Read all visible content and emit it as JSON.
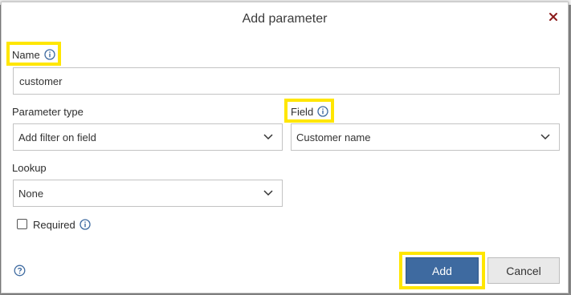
{
  "dialog": {
    "title": "Add parameter",
    "close_icon": "close-icon"
  },
  "name": {
    "label": "Name",
    "value": "customer",
    "info_icon": "info-icon"
  },
  "parameter_type": {
    "label": "Parameter type",
    "selected": "Add filter on field"
  },
  "field": {
    "label": "Field",
    "selected": "Customer name",
    "info_icon": "info-icon"
  },
  "lookup": {
    "label": "Lookup",
    "selected": "None"
  },
  "required": {
    "label": "Required",
    "checked": false,
    "info_icon": "info-icon"
  },
  "footer": {
    "help_icon": "question-circle-icon",
    "add_label": "Add",
    "cancel_label": "Cancel"
  },
  "colors": {
    "primary_button": "#3e6aa0",
    "highlight": "#ffe600",
    "close_icon": "#8b1a1a",
    "info_icon": "#3e6aa0"
  }
}
